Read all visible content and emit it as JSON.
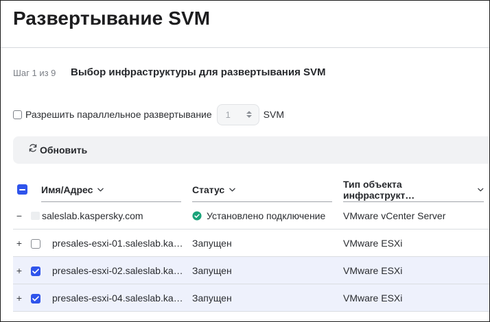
{
  "page": {
    "title": "Развертывание SVM"
  },
  "step": {
    "label": "Шаг 1 из 9",
    "title": "Выбор инфраструктуры для развертывания SVM"
  },
  "parallel": {
    "label": "Разрешить параллельное развертывание",
    "value": "1",
    "unit": "SVM",
    "checked": false
  },
  "toolbar": {
    "refresh_label": "Обновить"
  },
  "table": {
    "columns": [
      "Имя/Адрес",
      "Статус",
      "Тип объекта инфраструкт…"
    ],
    "rows": [
      {
        "expander": "−",
        "name": "saleslab.kaspersky.com",
        "status": "Установлено подключение",
        "type": "VMware vCenter Server",
        "checked": null
      },
      {
        "expander": "+",
        "name": "presales-esxi-01.saleslab.ka…",
        "status": "Запущен",
        "type": "VMware ESXi",
        "checked": false
      },
      {
        "expander": "+",
        "name": "presales-esxi-02.saleslab.ka…",
        "status": "Запущен",
        "type": "VMware ESXi",
        "checked": true
      },
      {
        "expander": "+",
        "name": "presales-esxi-04.saleslab.ka…",
        "status": "Запущен",
        "type": "VMware ESXi",
        "checked": true
      }
    ]
  },
  "colors": {
    "accent": "#2f54eb",
    "success": "#1aa37a",
    "selected_row": "#eef1fc",
    "toolbar_bg": "#f1f2f4"
  },
  "icons": {
    "refresh": "refresh-icon",
    "sort": "chevron-down-icon",
    "status_ok": "check-circle-icon",
    "host": "host-icon"
  }
}
